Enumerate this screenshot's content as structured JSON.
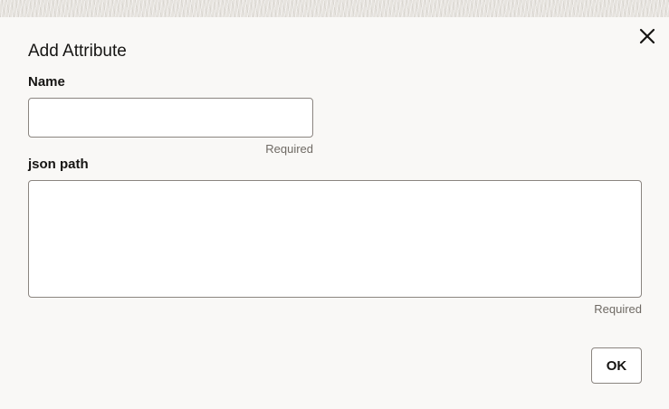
{
  "dialog": {
    "title": "Add Attribute",
    "close_icon": "close-icon",
    "ok_label": "OK"
  },
  "fields": {
    "name": {
      "label": "Name",
      "value": "",
      "placeholder": "",
      "hint": "Required"
    },
    "json_path": {
      "label": "json path",
      "value": "",
      "placeholder": "",
      "hint": "Required"
    }
  },
  "colors": {
    "background": "#f9f8f6",
    "text": "#161513",
    "border": "#8b8580",
    "hint": "#6f6a64"
  }
}
